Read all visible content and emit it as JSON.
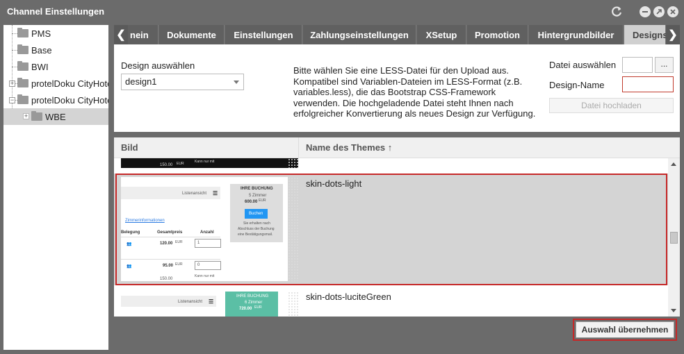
{
  "window": {
    "title": "Channel Einstellungen"
  },
  "tree": {
    "items": [
      {
        "label": "PMS"
      },
      {
        "label": "Base"
      },
      {
        "label": "BWI"
      },
      {
        "label": "protelDoku CityHotel"
      },
      {
        "label": "protelDoku CityHotel"
      },
      {
        "label": "WBE"
      }
    ]
  },
  "tabs": {
    "items": [
      {
        "label": "nein"
      },
      {
        "label": "Dokumente"
      },
      {
        "label": "Einstellungen"
      },
      {
        "label": "Zahlungseinstellungen"
      },
      {
        "label": "XSetup"
      },
      {
        "label": "Promotion"
      },
      {
        "label": "Hintergrundbilder"
      },
      {
        "label": "Designs"
      }
    ],
    "prev_arrow": "❮",
    "next_arrow": "❯"
  },
  "design": {
    "label": "Design auswählen",
    "selected": "design1",
    "description": "Bitte wählen Sie eine LESS-Datei für den Upload aus. Kompatibel sind Variablen-Dateien im LESS-Format (z.B. variables.less), die das Bootstrap CSS-Framework verwenden. Die hochgeladende Datei steht Ihnen nach erfolgreicher Konvertierung als neues Design zur Verfügung.",
    "file_label": "Datei auswählen",
    "browse_label": "...",
    "name_label": "Design-Name",
    "upload_label": "Datei hochladen"
  },
  "grid": {
    "col_image": "Bild",
    "col_name": "Name des Themes ↑",
    "rows": [
      {
        "name": "skin-dots-light"
      },
      {
        "name": "skin-dots-luciteGreen"
      }
    ],
    "thumb_light": {
      "list_view": "Listenansicht",
      "booking_title": "IHRE BUCHUNG",
      "rooms": "5 Zimmer",
      "price": "600.00",
      "currency": "EUR",
      "book": "Buchen",
      "note1": "Sie erhalten nach",
      "note2": "Abschluss der Buchung",
      "note3": "eine Bestätigungsmail.",
      "room_info": "Zimmerinformationen",
      "col_occ": "Belegung",
      "col_total": "Gesamtpreis",
      "col_count": "Anzahl",
      "row1_price": "120.00",
      "row1_count": "1",
      "row2_price": "95.00",
      "row2_count": "0",
      "row3_price": "150.00",
      "cut_text": "Kann nur mit"
    },
    "thumb_top": {
      "price": "150.00",
      "currency": "EUR",
      "cut_text": "Kann nur mit"
    },
    "thumb_green": {
      "list_view": "Listenansicht",
      "booking_title": "IHRE BUCHUNG",
      "rooms": "6 Zimmer",
      "price": "720.00",
      "currency": "EUR"
    }
  },
  "footer": {
    "apply_label": "Auswahl übernehmen"
  },
  "colors": {
    "accent_red": "#c62828",
    "tab_active": "#d0d0d0",
    "book_blue": "#2196f3",
    "green": "#5bbfa5"
  }
}
